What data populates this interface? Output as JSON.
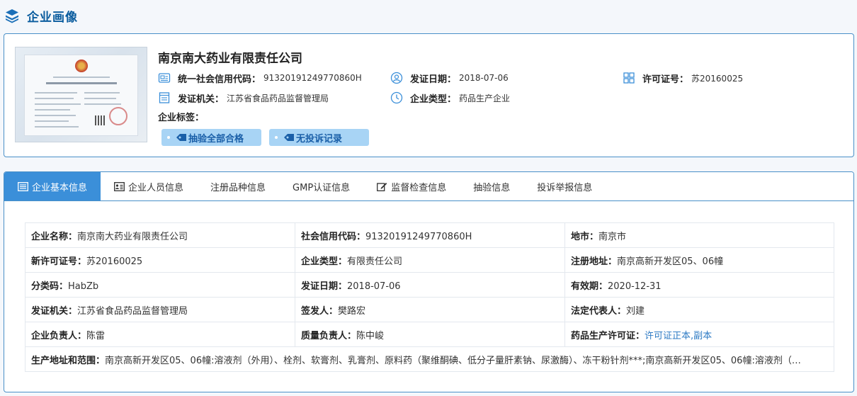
{
  "header": {
    "title": "企业画像"
  },
  "profile": {
    "company_name": "南京南大药业有限责任公司",
    "credit_code_label": "统一社会信用代码：",
    "credit_code": "91320191249770860H",
    "issue_date_label": "发证日期：",
    "issue_date": "2018-07-06",
    "license_no_label": "许可证号：",
    "license_no": "苏20160025",
    "issuer_label": "发证机关：",
    "issuer": "江苏省食品药品监督管理局",
    "company_type_label": "企业类型：",
    "company_type": "药品生产企业",
    "tags_label": "企业标签：",
    "tags": [
      "抽验全部合格",
      "无投诉记录"
    ]
  },
  "tabs": [
    {
      "label": "企业基本信息",
      "icon": "list-card-icon",
      "active": true
    },
    {
      "label": "企业人员信息",
      "icon": "id-card-icon",
      "active": false
    },
    {
      "label": "注册品种信息",
      "icon": "",
      "active": false
    },
    {
      "label": "GMP认证信息",
      "icon": "",
      "active": false
    },
    {
      "label": "监督检查信息",
      "icon": "edit-icon",
      "active": false
    },
    {
      "label": "抽验信息",
      "icon": "",
      "active": false
    },
    {
      "label": "投诉举报信息",
      "icon": "",
      "active": false
    }
  ],
  "details": {
    "rows": [
      [
        {
          "k": "企业名称：",
          "v": "南京南大药业有限责任公司"
        },
        {
          "k": "社会信用代码：",
          "v": "91320191249770860H"
        },
        {
          "k": "地市：",
          "v": "南京市"
        }
      ],
      [
        {
          "k": "新许可证号：",
          "v": "苏20160025"
        },
        {
          "k": "企业类型：",
          "v": "有限责任公司"
        },
        {
          "k": "注册地址：",
          "v": "南京高新开发区05、06幢"
        }
      ],
      [
        {
          "k": "分类码：",
          "v": "HabZb"
        },
        {
          "k": "发证日期：",
          "v": "2018-07-06"
        },
        {
          "k": "有效期：",
          "v": "2020-12-31"
        }
      ],
      [
        {
          "k": "发证机关：",
          "v": "江苏省食品药品监督管理局"
        },
        {
          "k": "签发人：",
          "v": "樊路宏"
        },
        {
          "k": "法定代表人：",
          "v": "刘建"
        }
      ],
      [
        {
          "k": "企业负责人：",
          "v": "陈雷"
        },
        {
          "k": "质量负责人：",
          "v": "陈中峻"
        },
        {
          "k": "药品生产许可证：",
          "v": "许可证正本,副本"
        }
      ]
    ],
    "scope_label": "生产地址和范围：",
    "scope_value": "南京高新开发区05、06幢:溶液剂（外用）、栓剂、软膏剂、乳膏剂、原料药（聚维酮碘、低分子量肝素钠、尿激酶）、冻干粉针剂***;南京高新开发区05、06幢:溶液剂（…"
  },
  "colors": {
    "accent": "#3b8fd9",
    "title": "#0a5c9e",
    "tag_bg": "#a8d4f5",
    "tag_text": "#1a5fa8",
    "link": "#2e7bc4"
  }
}
